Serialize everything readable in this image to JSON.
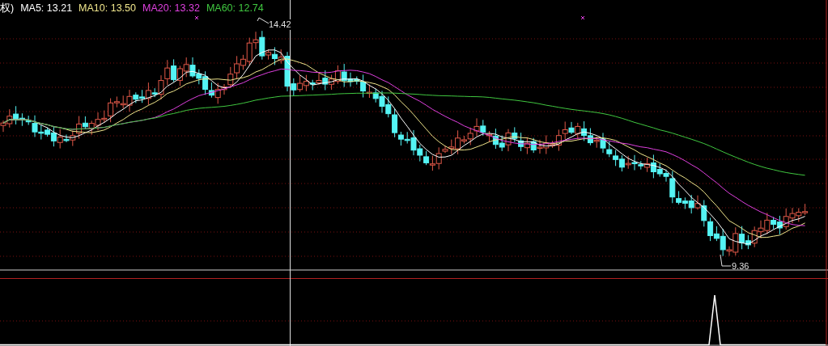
{
  "header": {
    "prefix": "权)",
    "indicators": [
      {
        "label": "MA5: 13.21",
        "color": "#ffffff"
      },
      {
        "label": "MA10: 13.50",
        "color": "#f0e68c"
      },
      {
        "label": "MA20: 13.32",
        "color": "#e040e0"
      },
      {
        "label": "MA60: 12.74",
        "color": "#40c840"
      }
    ]
  },
  "chart": {
    "high_label": "14.42",
    "low_label": "9.36"
  }
}
